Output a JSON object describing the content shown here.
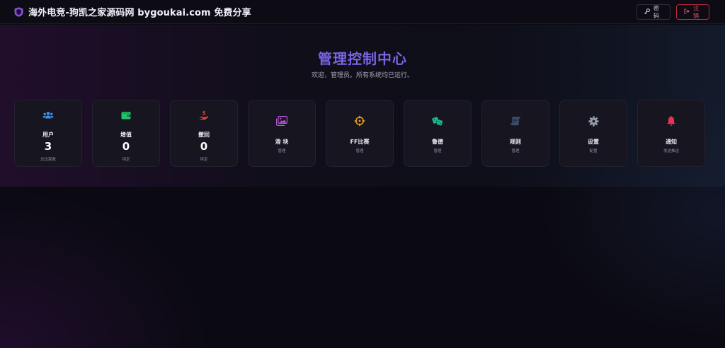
{
  "header": {
    "title": "海外电竞-狗凯之家源码网 bygoukai.com 免费分享",
    "password_label": "密码",
    "logout_label": "注销"
  },
  "hero": {
    "title": "管理控制中心",
    "subtitle": "欢迎，管理员。所有系统均已运行。"
  },
  "cards": [
    {
      "label": "用户",
      "value": "3",
      "sub": "总玩家数",
      "icon": "users-icon",
      "color": "#3f8fe0"
    },
    {
      "label": "增值",
      "value": "0",
      "sub": "待定",
      "icon": "wallet-icon",
      "color": "#22c26a"
    },
    {
      "label": "撤回",
      "value": "0",
      "sub": "待定",
      "icon": "hand-money-icon",
      "color": "#e8463a"
    },
    {
      "label": "滑 块",
      "sub": "管理",
      "icon": "images-icon",
      "color": "#b456d8"
    },
    {
      "label": "FF比赛",
      "sub": "管理",
      "icon": "crosshairs-icon",
      "color": "#f0a21c"
    },
    {
      "label": "鲁德",
      "sub": "管理",
      "icon": "dice-icon",
      "color": "#19b98a"
    },
    {
      "label": "规则",
      "sub": "管理",
      "icon": "scroll-icon",
      "color": "#3a4c66"
    },
    {
      "label": "设置",
      "sub": "配置",
      "icon": "gear-icon",
      "color": "#9aa0aa"
    },
    {
      "label": "通知",
      "sub": "发送推送",
      "icon": "bell-icon",
      "color": "#e8324f"
    }
  ]
}
